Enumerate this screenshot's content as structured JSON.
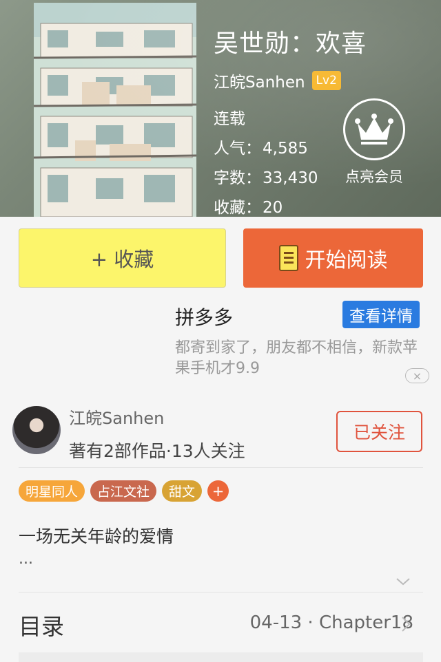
{
  "book": {
    "title": "吴世勋：欢喜",
    "author": "江皖Sanhen",
    "level": "Lv2",
    "status": "连载",
    "popularity_label": "人气：",
    "popularity": "4,585",
    "words_label": "字数：",
    "words": "33,430",
    "favorites_label": "收藏：",
    "favorites": "20"
  },
  "vip": {
    "label": "点亮会员",
    "icon": "crown-icon"
  },
  "actions": {
    "favorite": "+ 收藏",
    "read": "开始阅读"
  },
  "ad": {
    "title": "拼多多",
    "detail_button": "查看详情",
    "text": "都寄到家了，朋友都不相信，新款苹果手机才9.9",
    "close": "×"
  },
  "author_section": {
    "name": "江皖Sanhen",
    "stats": "著有2部作品·13人关注",
    "follow_button": "已关注"
  },
  "tags": [
    {
      "label": "明星同人",
      "color": "#f6a63a"
    },
    {
      "label": "占江文社",
      "color": "#c9684e"
    },
    {
      "label": "甜文",
      "color": "#d8a334"
    }
  ],
  "tag_add": "+",
  "summary": {
    "text": "一场无关年龄的爱情",
    "more": "..."
  },
  "toc": {
    "title": "目录",
    "latest": "04-13 · Chapter18"
  },
  "colors": {
    "accent": "#ec6739",
    "favorite_bg": "#fcf56b",
    "ad_blue": "#2a7be0",
    "level_badge": "#f6b321"
  }
}
